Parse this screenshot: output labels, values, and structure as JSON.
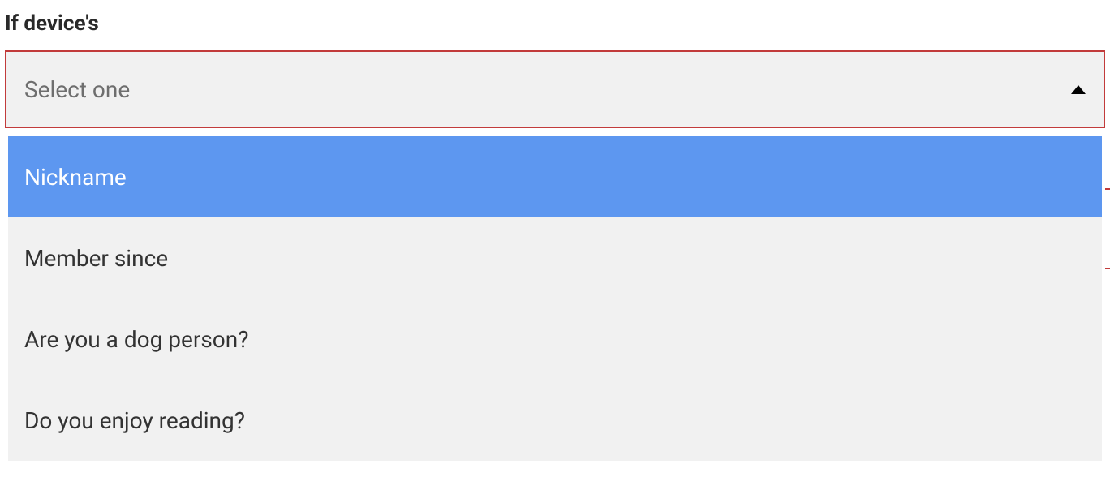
{
  "field": {
    "label": "If device's",
    "placeholder": "Select one"
  },
  "options": [
    {
      "label": "Nickname",
      "highlighted": true
    },
    {
      "label": "Member since",
      "highlighted": false
    },
    {
      "label": "Are you a dog person?",
      "highlighted": false
    },
    {
      "label": "Do you enjoy reading?",
      "highlighted": false
    }
  ],
  "colors": {
    "error_border": "#c23b3b",
    "highlight": "#5d97f0",
    "panel_bg": "#f1f1f1"
  }
}
